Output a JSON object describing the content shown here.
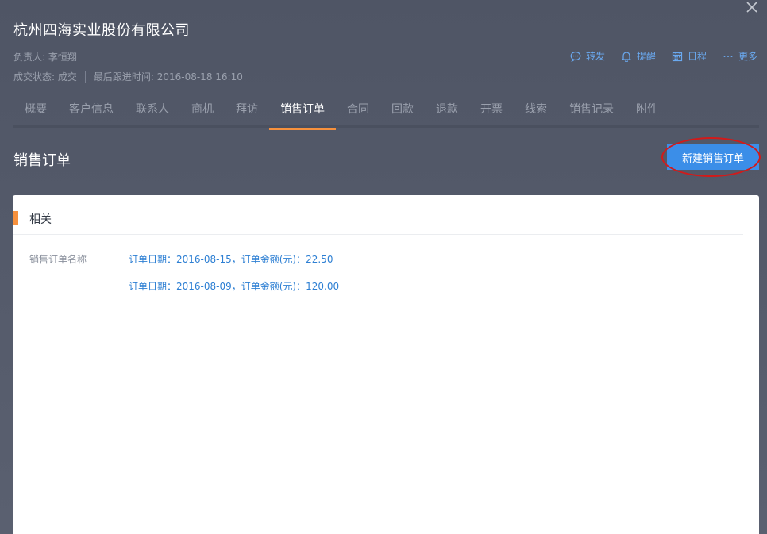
{
  "header": {
    "company_name": "杭州四海实业股份有限公司",
    "owner": "负责人: 李恒翔",
    "status": "成交状态: 成交",
    "last_follow": "最后跟进时间: 2016-08-18 16:10"
  },
  "actions": [
    {
      "label": "转发",
      "icon": "chat-icon"
    },
    {
      "label": "提醒",
      "icon": "bell-icon"
    },
    {
      "label": "日程",
      "icon": "calendar-icon"
    },
    {
      "label": "更多",
      "icon": "more-icon"
    }
  ],
  "tabs": [
    {
      "label": "概要"
    },
    {
      "label": "客户信息"
    },
    {
      "label": "联系人"
    },
    {
      "label": "商机"
    },
    {
      "label": "拜访"
    },
    {
      "label": "销售订单",
      "active": true
    },
    {
      "label": "合同"
    },
    {
      "label": "回款"
    },
    {
      "label": "退款"
    },
    {
      "label": "开票"
    },
    {
      "label": "线索"
    },
    {
      "label": "销售记录"
    },
    {
      "label": "附件"
    }
  ],
  "section": {
    "title": "销售订单",
    "new_button": "新建销售订单"
  },
  "card": {
    "header": "相关",
    "field_label": "销售订单名称",
    "orders": [
      "订单日期：2016-08-15，订单金额(元)：22.50",
      "订单日期：2016-08-09，订单金额(元)：120.00"
    ]
  },
  "colors": {
    "accent_orange": "#f7913d",
    "primary_blue": "#3b8ee8",
    "link_blue": "#2d7fd3",
    "highlight_red": "#d21a1a"
  }
}
